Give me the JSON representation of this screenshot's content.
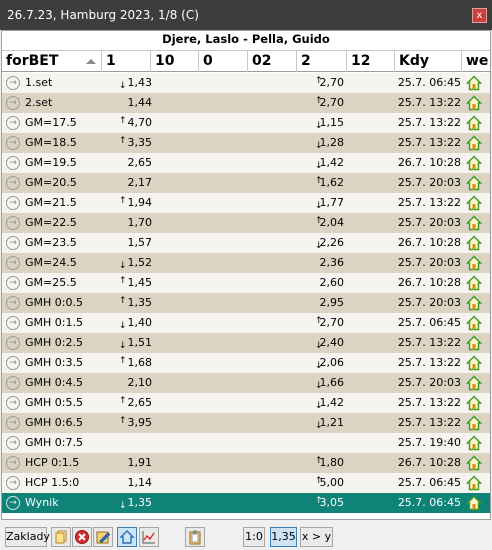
{
  "window": {
    "title": "26.7.23, Hamburg 2023, 1/8 (C)",
    "close_label": "x"
  },
  "match": {
    "title": "Djere, Laslo - Pella, Guido"
  },
  "columns": {
    "name": "forBET",
    "c1": "1",
    "c10": "10",
    "c0": "0",
    "c02": "02",
    "c2": "2",
    "c12": "12",
    "kdy": "Kdy",
    "we": "we"
  },
  "rows": [
    {
      "name": "1.set",
      "odd1": "1,43",
      "arrow1": "down",
      "odd2": "2,70",
      "arrow2": "up",
      "kdy": "25.7. 06:45"
    },
    {
      "name": "2.set",
      "odd1": "1,44",
      "arrow1": "",
      "odd2": "2,70",
      "arrow2": "up",
      "kdy": "25.7. 13:22"
    },
    {
      "name": "GM=17.5",
      "odd1": "4,70",
      "arrow1": "up",
      "odd2": "1,15",
      "arrow2": "down",
      "kdy": "25.7. 13:22"
    },
    {
      "name": "GM=18.5",
      "odd1": "3,35",
      "arrow1": "up",
      "odd2": "1,28",
      "arrow2": "down",
      "kdy": "25.7. 13:22"
    },
    {
      "name": "GM=19.5",
      "odd1": "2,65",
      "arrow1": "",
      "odd2": "1,42",
      "arrow2": "down",
      "kdy": "26.7. 10:28"
    },
    {
      "name": "GM=20.5",
      "odd1": "2,17",
      "arrow1": "",
      "odd2": "1,62",
      "arrow2": "up",
      "kdy": "25.7. 20:03"
    },
    {
      "name": "GM=21.5",
      "odd1": "1,94",
      "arrow1": "up",
      "odd2": "1,77",
      "arrow2": "down",
      "kdy": "25.7. 13:22"
    },
    {
      "name": "GM=22.5",
      "odd1": "1,70",
      "arrow1": "",
      "odd2": "2,04",
      "arrow2": "up",
      "kdy": "25.7. 20:03"
    },
    {
      "name": "GM=23.5",
      "odd1": "1,57",
      "arrow1": "",
      "odd2": "2,26",
      "arrow2": "down",
      "kdy": "26.7. 10:28"
    },
    {
      "name": "GM=24.5",
      "odd1": "1,52",
      "arrow1": "down",
      "odd2": "2,36",
      "arrow2": "",
      "kdy": "25.7. 20:03"
    },
    {
      "name": "GM=25.5",
      "odd1": "1,45",
      "arrow1": "up",
      "odd2": "2,60",
      "arrow2": "",
      "kdy": "26.7. 10:28"
    },
    {
      "name": "GMH 0:0.5",
      "odd1": "1,35",
      "arrow1": "up",
      "odd2": "2,95",
      "arrow2": "",
      "kdy": "25.7. 20:03"
    },
    {
      "name": "GMH 0:1.5",
      "odd1": "1,40",
      "arrow1": "down",
      "odd2": "2,70",
      "arrow2": "up",
      "kdy": "25.7. 06:45"
    },
    {
      "name": "GMH 0:2.5",
      "odd1": "1,51",
      "arrow1": "down",
      "odd2": "2,40",
      "arrow2": "down",
      "kdy": "25.7. 13:22"
    },
    {
      "name": "GMH 0:3.5",
      "odd1": "1,68",
      "arrow1": "up",
      "odd2": "2,06",
      "arrow2": "down",
      "kdy": "25.7. 13:22"
    },
    {
      "name": "GMH 0:4.5",
      "odd1": "2,10",
      "arrow1": "",
      "odd2": "1,66",
      "arrow2": "down",
      "kdy": "25.7. 20:03"
    },
    {
      "name": "GMH 0:5.5",
      "odd1": "2,65",
      "arrow1": "up",
      "odd2": "1,42",
      "arrow2": "down",
      "kdy": "25.7. 13:22"
    },
    {
      "name": "GMH 0:6.5",
      "odd1": "3,95",
      "arrow1": "up",
      "odd2": "1,21",
      "arrow2": "down",
      "kdy": "25.7. 13:22"
    },
    {
      "name": "GMH 0:7.5",
      "odd1": "",
      "arrow1": "",
      "odd2": "",
      "arrow2": "",
      "kdy": "25.7. 19:40"
    },
    {
      "name": "HCP 0:1.5",
      "odd1": "1,91",
      "arrow1": "",
      "odd2": "1,80",
      "arrow2": "up",
      "kdy": "26.7. 10:28"
    },
    {
      "name": "HCP 1.5:0",
      "odd1": "1,14",
      "arrow1": "",
      "odd2": "5,00",
      "arrow2": "up",
      "kdy": "25.7. 06:45"
    },
    {
      "name": "Wynik",
      "odd1": "1,35",
      "arrow1": "down",
      "odd2": "3,05",
      "arrow2": "up",
      "kdy": "25.7. 06:45",
      "selected": true
    }
  ],
  "toolbar": {
    "zaklady_label": "Zaklady",
    "ratio_label": "1:0",
    "value_label": "1,35",
    "xy_label": "x > y"
  },
  "colors": {
    "odd_row": "#dcd4c2",
    "even_row": "#f6f4ee",
    "selected_row": "#0f8378",
    "title_bar": "#3d3d3d",
    "close_button": "#c8403e",
    "house_green": "#3a9a2a",
    "house_orange": "#e08a1e"
  },
  "icons": {
    "row_go": "circle-arrow-right-icon",
    "row_we": "house-icon"
  }
}
